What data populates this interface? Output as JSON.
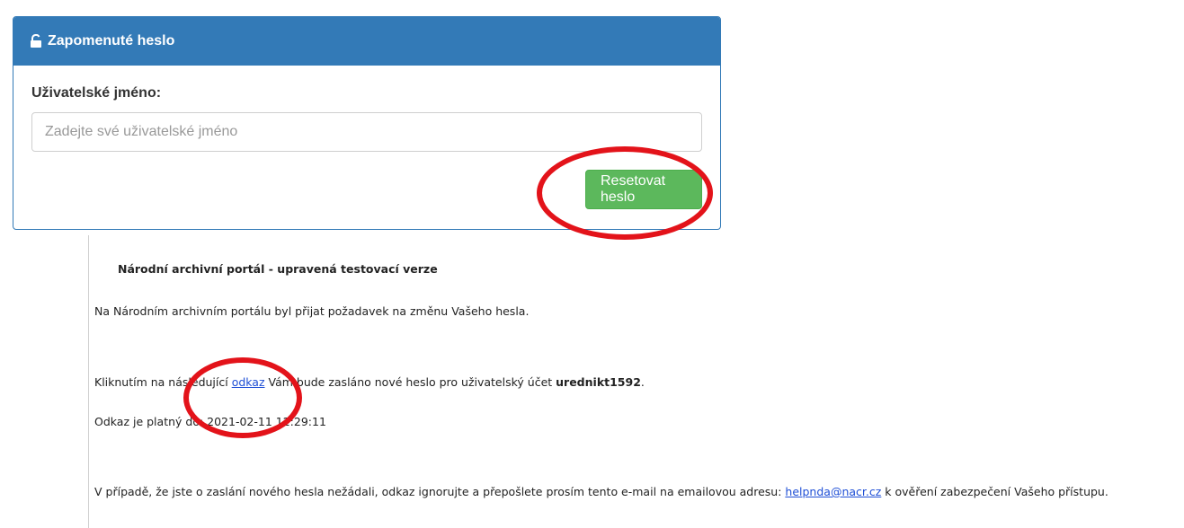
{
  "panel": {
    "title": "Zapomenuté heslo",
    "username_label": "Uživatelské jméno:",
    "username_placeholder": "Zadejte své uživatelské jméno",
    "reset_button": "Resetovat heslo"
  },
  "email": {
    "title": "Národní archivní portál - upravená testovací verze",
    "line1": "Na Národním archivním portálu byl přijat požadavek na změnu Vašeho hesla.",
    "line2_prefix": "Kliknutím na následující ",
    "line2_link": "odkaz",
    "line2_middle": " Vám bude zasláno nové heslo pro uživatelský účet ",
    "line2_user": "urednikt1592",
    "line2_suffix": ".",
    "line3": "Odkaz je platný do: 2021-02-11 12:29:11",
    "line4_prefix": "V případě, že jste o zaslání nového hesla nežádali, odkaz ignorujte a přepošlete prosím tento e-mail na emailovou adresu: ",
    "line4_link": "helpnda@nacr.cz",
    "line4_suffix": " k ověření zabezpečení Vašeho přístupu."
  },
  "colors": {
    "panel_header": "#337ab7",
    "button": "#5cb85c",
    "annotation": "#e3131a",
    "link": "#1f4fd6"
  }
}
